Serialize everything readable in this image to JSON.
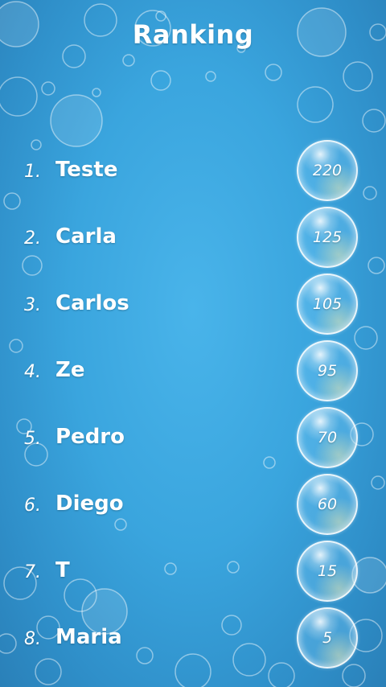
{
  "header": {
    "title": "Ranking"
  },
  "ranking": [
    {
      "rank": "1.",
      "name": "Teste",
      "score": "220"
    },
    {
      "rank": "2.",
      "name": "Carla",
      "score": "125"
    },
    {
      "rank": "3.",
      "name": "Carlos",
      "score": "105"
    },
    {
      "rank": "4.",
      "name": "Ze",
      "score": "95"
    },
    {
      "rank": "5.",
      "name": "Pedro",
      "score": "70"
    },
    {
      "rank": "6.",
      "name": "Diego",
      "score": "60"
    },
    {
      "rank": "7.",
      "name": "T",
      "score": "15"
    },
    {
      "rank": "8.",
      "name": "Maria",
      "score": "5"
    }
  ],
  "colors": {
    "background": "#3aa5de",
    "text": "#ffffff"
  }
}
